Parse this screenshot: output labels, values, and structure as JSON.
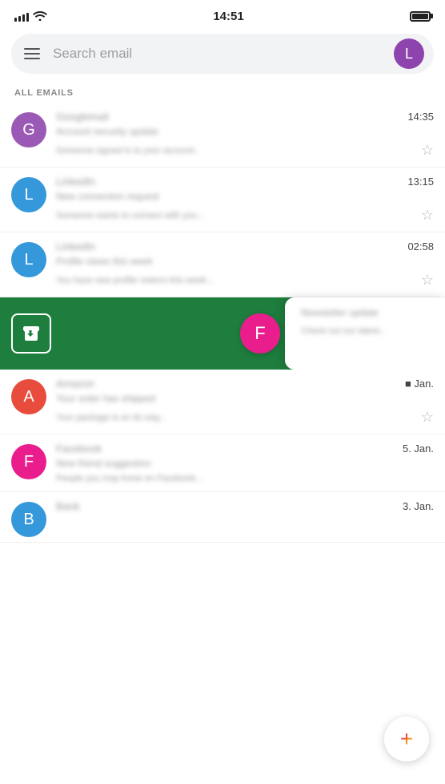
{
  "statusBar": {
    "time": "14:51"
  },
  "searchBar": {
    "placeholder": "Search email",
    "avatarLabel": "L",
    "avatarColor": "#8e44ad"
  },
  "sectionLabel": "ALL EMAILS",
  "emails": [
    {
      "id": 1,
      "avatarLabel": "G",
      "avatarColor": "#9b59b6",
      "time": "14:35",
      "starred": false
    },
    {
      "id": 2,
      "avatarLabel": "L",
      "avatarColor": "#3498db",
      "time": "13:15",
      "starred": false
    },
    {
      "id": 3,
      "avatarLabel": "L",
      "avatarColor": "#3498db",
      "time": "02:58",
      "starred": false
    },
    {
      "id": 5,
      "avatarLabel": "A",
      "avatarColor": "#e74c3c",
      "time": "Jan.",
      "starred": false
    },
    {
      "id": 6,
      "avatarLabel": "F",
      "avatarColor": "#e91e8c",
      "time": "5. Jan.",
      "starred": false
    },
    {
      "id": 7,
      "avatarLabel": "B",
      "avatarColor": "#3498db",
      "time": "3. Jan.",
      "starred": false
    }
  ],
  "archivedItem": {
    "floatingAvatarLabel": "F",
    "floatingAvatarColor": "#e91e8c"
  },
  "fab": {
    "label": "+"
  }
}
